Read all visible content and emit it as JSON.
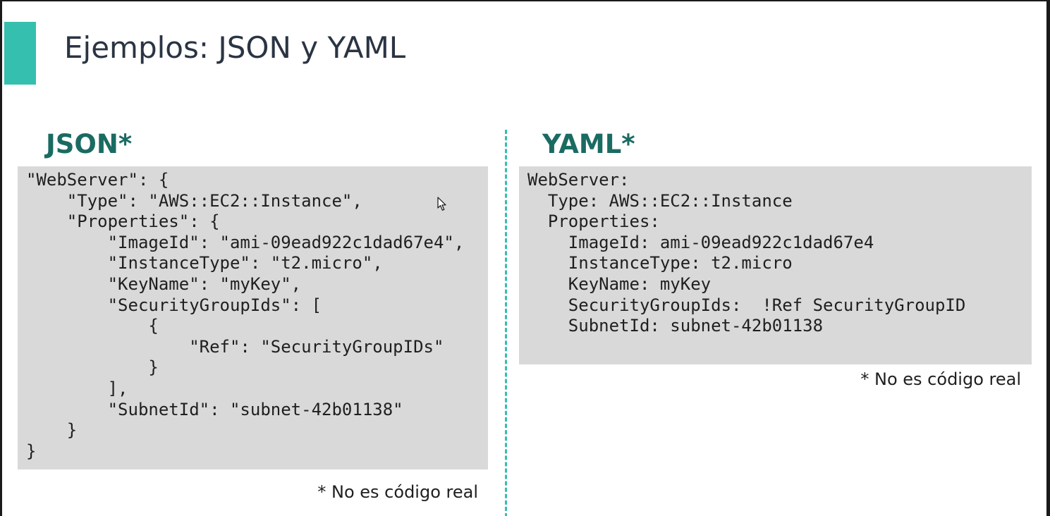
{
  "slide": {
    "title": "Ejemplos: JSON y YAML",
    "accent_color": "#35bfae",
    "heading_color": "#1a6b62"
  },
  "json_panel": {
    "heading": "JSON*",
    "code_lines": [
      "\"WebServer\": {",
      "    \"Type\": \"AWS::EC2::Instance\",",
      "    \"Properties\": {",
      "        \"ImageId\": \"ami-09ead922c1dad67e4\",",
      "        \"InstanceType\": \"t2.micro\",",
      "        \"KeyName\": \"myKey\",",
      "        \"SecurityGroupIds\": [",
      "            {",
      "                \"Ref\": \"SecurityGroupIDs\"",
      "            }",
      "        ],",
      "        \"SubnetId\": \"subnet-42b01138\"",
      "    }",
      "}"
    ],
    "footnote": "* No es código real"
  },
  "yaml_panel": {
    "heading": "YAML*",
    "code_lines": [
      "WebServer:",
      "  Type: AWS::EC2::Instance",
      "  Properties:",
      "    ImageId: ami-09ead922c1dad67e4",
      "    InstanceType: t2.micro",
      "    KeyName: myKey",
      "    SecurityGroupIds:  !Ref SecurityGroupID",
      "    SubnetId: subnet-42b01138"
    ],
    "footnote": "* No es código real"
  },
  "icons": {
    "cursor": "mouse-pointer-icon"
  }
}
